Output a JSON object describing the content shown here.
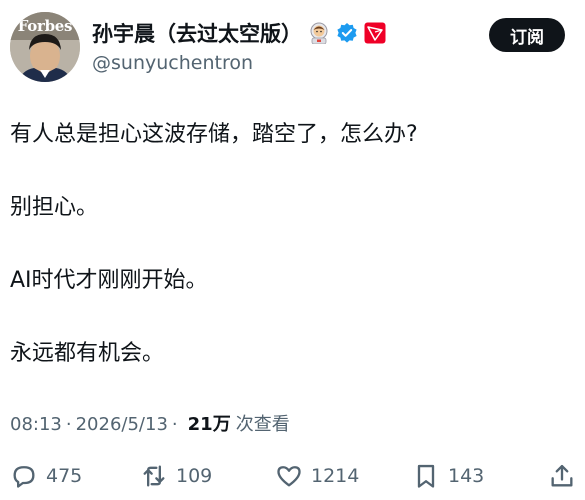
{
  "user": {
    "display_name": "孙宇晨（去过太空版）",
    "handle": "@sunyuchentron",
    "avatar_brand": "Forbes",
    "badges": [
      "astronaut-emoji",
      "verified-check-icon",
      "tron-logo-icon"
    ]
  },
  "header": {
    "subscribe_label": "订阅"
  },
  "tweet": {
    "lines": [
      "有人总是担心这波存储，踏空了，怎么办?",
      "别担心。",
      "AI时代才刚刚开始。",
      "永远都有机会。"
    ]
  },
  "meta": {
    "time": "08:13",
    "separator": "·",
    "date": "2026/5/13",
    "views_count": "21万",
    "views_label": "次查看"
  },
  "actions": {
    "replies": "475",
    "retweets": "109",
    "likes": "1214",
    "bookmarks": "143"
  },
  "colors": {
    "text": "#0f1419",
    "secondary": "#536471",
    "verified": "#1d9bf0",
    "tron": "#ef0027",
    "button_bg": "#0f1419"
  }
}
